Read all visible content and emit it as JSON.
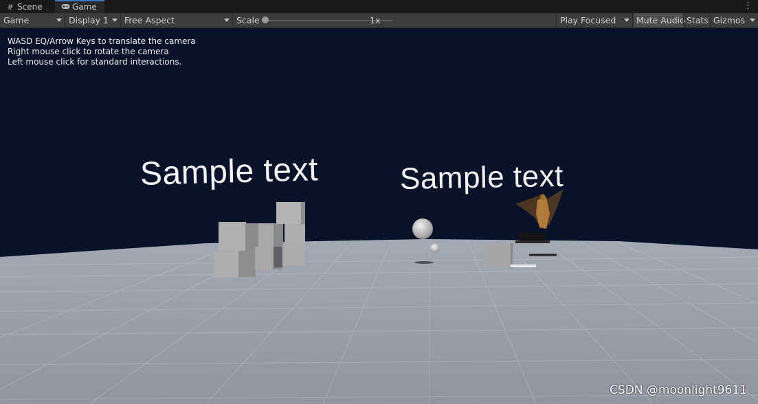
{
  "tabs": [
    {
      "label": "Scene",
      "icon": "grid-icon"
    },
    {
      "label": "Game",
      "icon": "gamepad-icon"
    }
  ],
  "toolbar": {
    "view_select": "Game",
    "display_select": "Display 1",
    "aspect_select": "Free Aspect",
    "scale_label": "Scale",
    "scale_value": "1x",
    "scale_fraction": 0.0,
    "play_mode_select": "Play Focused",
    "mute_audio": "Mute Audio",
    "stats": "Stats",
    "gizmos": "Gizmos"
  },
  "viewport": {
    "help_lines": [
      "WASD EQ/Arrow Keys to translate the camera",
      "Right mouse click to rotate the camera",
      "Left mouse click for standard interactions."
    ],
    "world_text_1": "Sample text",
    "world_text_2": "Sample text",
    "watermark": "CSDN @moonlight9611"
  },
  "colors": {
    "sky": "#081229",
    "ground": "#a7adb8",
    "accent_tab": "#3a79bb"
  }
}
